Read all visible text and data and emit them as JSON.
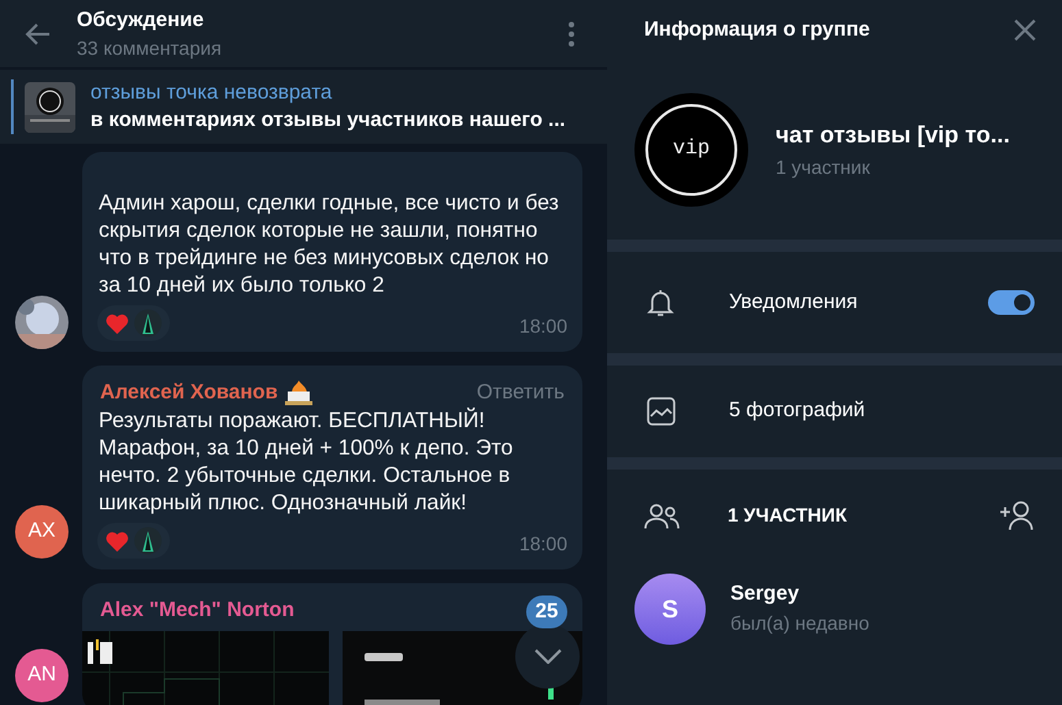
{
  "chat": {
    "title": "Обсуждение",
    "subtitle": "33 комментария"
  },
  "pinned": {
    "title": "отзывы точка невозврата",
    "text": "в комментариях отзывы участников нашего ..."
  },
  "messages": [
    {
      "kind": "text",
      "avatar": {
        "kind": "picture"
      },
      "text": "Админ харош, сделки годные, все чисто и без скрытия сделок которые не зашли, понятно что в трейдинге не без минусовых сделок но за 10 дней их было только 2",
      "reactions": [
        {
          "kind": "heart"
        },
        {
          "kind": "sticker"
        }
      ],
      "time": "18:00"
    },
    {
      "kind": "text",
      "avatar": {
        "kind": "initials",
        "text": "AX"
      },
      "color": "#e0644f",
      "author": "Алексей Хованов",
      "author_emoji": true,
      "reply": "Ответить",
      "text": "Результаты поражают. БЕСПЛАТНЫЙ! Марафон, за 10 дней + 100% к депо. Это нечто. 2 убыточные сделки. Остальное в шикарный плюс. Однозначный лайк!",
      "reactions": [
        {
          "kind": "heart"
        },
        {
          "kind": "sticker"
        }
      ],
      "time": "18:00"
    },
    {
      "kind": "photos",
      "avatar": {
        "kind": "initials",
        "text": "AN"
      },
      "color": "#e45a92",
      "author": "Alex \"Mech\" Norton"
    }
  ],
  "unread": "25",
  "info": {
    "title": "Информация о группе",
    "avatar": "vip",
    "name": "чат отзывы [vip то...",
    "members": "1 участник",
    "notifications": {
      "label": "Уведомления",
      "on": true
    },
    "photos": "5 фотографий",
    "members_header": "1 УЧАСТНИК",
    "member_list": [
      {
        "initial": "S",
        "name": "Sergey",
        "status": "был(а) недавно"
      }
    ]
  }
}
